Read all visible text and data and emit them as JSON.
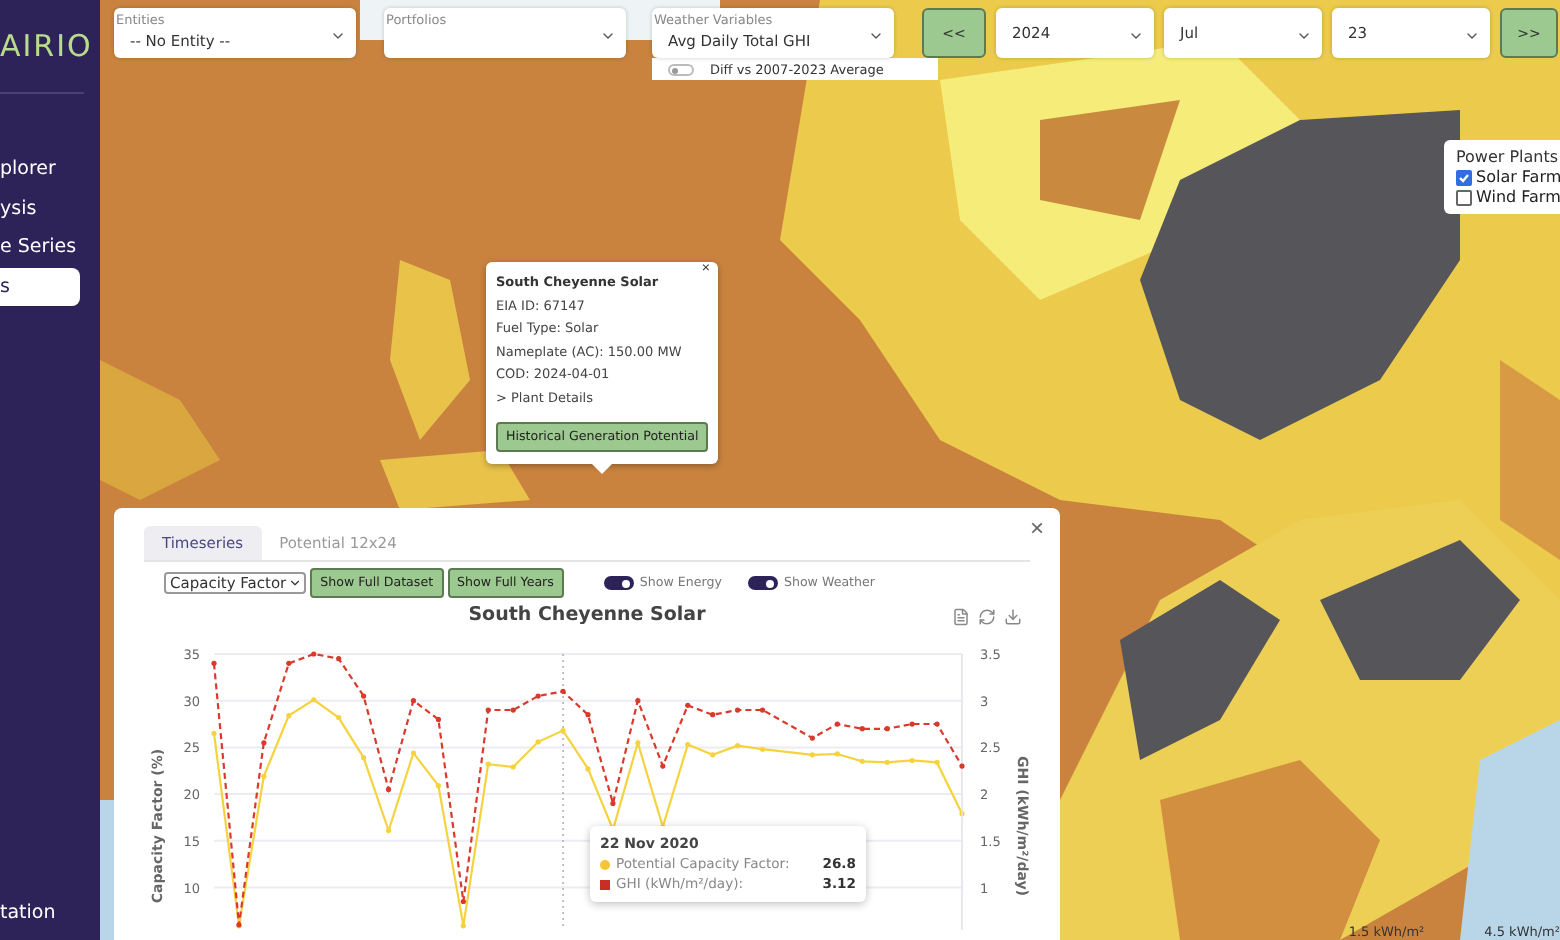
{
  "sidebar": {
    "logo": "AIRIO",
    "items": [
      {
        "label": "plorer",
        "selected": false
      },
      {
        "label": "ysis",
        "selected": false
      },
      {
        "label": "e Series",
        "selected": false
      },
      {
        "label": "s",
        "selected": true
      }
    ],
    "footer": "tation"
  },
  "filters": [
    {
      "label": "Entities",
      "value": "-- No Entity --"
    },
    {
      "label": "Portfolios"
    }
  ],
  "weather": {
    "label": "Weather Variables",
    "value": "Avg Daily Total GHI",
    "toggle": {
      "label": "Diff vs 2007-2023 Average",
      "on": false
    }
  },
  "date_nav": {
    "prev": "<<",
    "year": "2024",
    "month": "Jul",
    "day": "23",
    "next": ">>"
  },
  "legend": {
    "title": "Power Plants",
    "items": [
      {
        "label": "Solar Farm",
        "checked": true
      },
      {
        "label": "Wind Farm",
        "checked": false
      }
    ]
  },
  "popup": {
    "title": "South Cheyenne Solar",
    "lines": [
      "EIA ID: 67147",
      "Fuel Type: Solar",
      "Nameplate (AC): 150.00 MW",
      "COD: 2024-04-01"
    ],
    "link": "> Plant Details",
    "button": "Historical Generation Potential",
    "close": "×"
  },
  "panel": {
    "close": "×",
    "tabs": [
      {
        "label": "Timeseries",
        "selected": true
      },
      {
        "label": "Potential 12x24",
        "selected": false
      }
    ],
    "metric": "Capacity Factor",
    "buttons": [
      "Show Full Dataset",
      "Show Full Years"
    ],
    "toggles": [
      {
        "label": "Show Energy",
        "on": true
      },
      {
        "label": "Show Weather",
        "on": true
      }
    ],
    "chart_data": {
      "type": "line",
      "title": "South Cheyenne Solar",
      "ylabel": "Capacity Factor (%)",
      "grid": true,
      "ylim": [
        5,
        35
      ],
      "yticks": [
        10,
        15,
        20,
        25,
        30,
        35
      ],
      "series": [
        {
          "color": "#f5d33f",
          "line_style": "solid",
          "values": [
            26.5,
            5.9,
            21.9,
            28.4,
            30.1,
            28.2,
            23.9,
            16.1,
            24.4,
            20.9,
            5.9,
            23.2,
            22.9,
            25.6,
            26.8,
            22.7,
            16.2,
            25.5,
            16.5,
            25.3,
            24.2,
            25.2,
            24.8,
            null,
            24.2,
            24.3,
            23.5,
            23.4,
            23.6,
            23.4,
            17.9
          ]
        }
      ]
    },
    "weather_overlay": {
      "chart_data": {
        "type": "line",
        "ylabel": "GHI (kWh/m²/day)",
        "ylim": [
          0.5,
          3.5
        ],
        "yticks": [
          {
            "value": 1,
            "label": "1"
          },
          {
            "value": 1.5,
            "label": "1.5"
          },
          {
            "value": 2,
            "label": "2"
          },
          {
            "value": 2.5,
            "label": "2.5"
          },
          {
            "value": 3,
            "label": "3"
          },
          {
            "value": 3.5,
            "label": "3.5"
          }
        ],
        "series": [
          {
            "color": "#d93a2b",
            "line_style": "dashed",
            "values": [
              3.4,
              0.6,
              2.55,
              3.4,
              3.5,
              3.45,
              3.05,
              2.05,
              3.0,
              2.8,
              0.85,
              2.9,
              2.9,
              3.05,
              3.1,
              2.85,
              1.9,
              3.0,
              2.3,
              2.95,
              2.85,
              2.9,
              2.9,
              null,
              2.6,
              2.75,
              2.7,
              2.7,
              2.75,
              2.75,
              2.3
            ]
          }
        ]
      }
    },
    "tooltip": {
      "date": "22 Nov 2020",
      "rows": [
        {
          "label": "Potential Capacity Factor:",
          "value": "26.8",
          "color": "#f5c533"
        },
        {
          "label": "GHI (kWh/m²/day):",
          "value": "3.12",
          "color": "#c62f22"
        }
      ]
    }
  },
  "map_scale": [
    "1.5 kWh/m²",
    "4.5 kWh/m²"
  ]
}
